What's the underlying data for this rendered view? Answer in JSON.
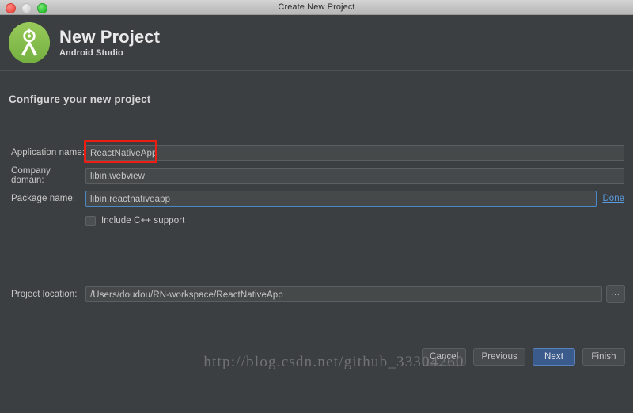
{
  "window": {
    "title": "Create New Project",
    "traffic_lights": [
      "close-red",
      "minimize-gray",
      "zoom-green"
    ]
  },
  "header": {
    "title": "New Project",
    "subtitle": "Android Studio",
    "logo_icon": "android-studio-logo-icon"
  },
  "main": {
    "section_title": "Configure your new project",
    "fields": [
      {
        "label": "Application name:",
        "value": "ReactNativeApp",
        "name": "application-name",
        "focused": false,
        "annotated": true
      },
      {
        "label": "Company domain:",
        "value": "libin.webview",
        "name": "company-domain",
        "focused": false,
        "annotated": false
      },
      {
        "label": "Package name:",
        "value": "libin.reactnativeapp",
        "name": "package-name",
        "focused": true,
        "annotated": false,
        "action_label": "Done"
      }
    ],
    "checkbox": {
      "label": "Include C++ support",
      "checked": false
    },
    "project_location": {
      "label": "Project location:",
      "value": "/Users/doudou/RN-workspace/ReactNativeApp",
      "browse_label": "..."
    }
  },
  "footer": {
    "buttons": [
      {
        "label": "Cancel",
        "name": "cancel-button",
        "primary": false
      },
      {
        "label": "Previous",
        "name": "previous-button",
        "primary": false
      },
      {
        "label": "Next",
        "name": "next-button",
        "primary": true
      },
      {
        "label": "Finish",
        "name": "finish-button",
        "primary": false
      }
    ]
  },
  "watermark": {
    "text": "http://blog.csdn.net/github_33304260"
  },
  "colors": {
    "background": "#3c3f41",
    "field_background": "#45494a",
    "accent_blue": "#4a88c7",
    "link_blue": "#5a9ae0",
    "annotation_red": "#ee1c11",
    "logo_green": "#79b741"
  }
}
